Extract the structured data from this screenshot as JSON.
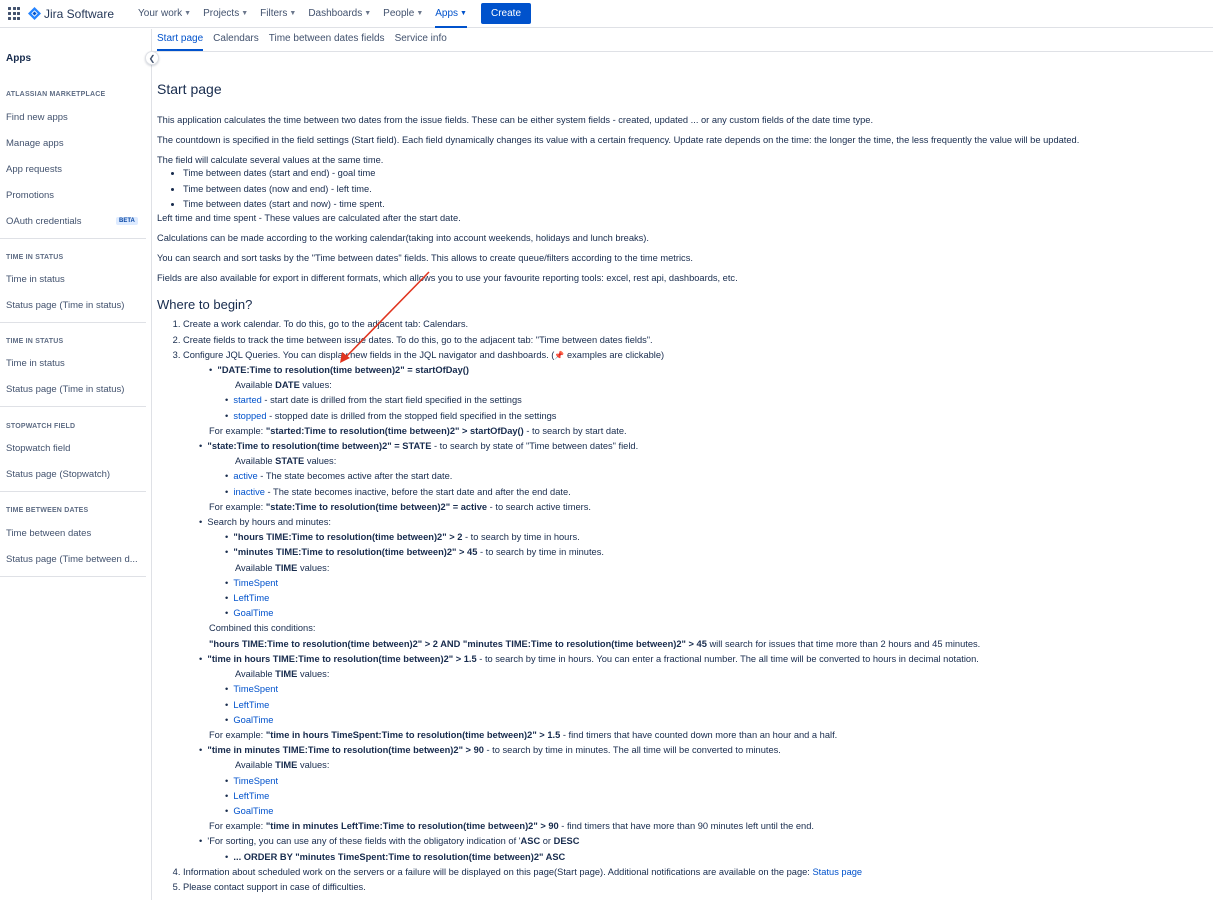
{
  "topbar": {
    "product": "Jira Software",
    "nav": [
      {
        "label": "Your work"
      },
      {
        "label": "Projects"
      },
      {
        "label": "Filters"
      },
      {
        "label": "Dashboards"
      },
      {
        "label": "People"
      },
      {
        "label": "Apps"
      }
    ],
    "create_label": "Create",
    "accent": "#0052cc"
  },
  "sidebar": {
    "title": "Apps",
    "sections": [
      {
        "heading": "ATLASSIAN MARKETPLACE",
        "items": [
          "Find new apps",
          "Manage apps",
          "App requests",
          "Promotions",
          "OAuth credentials"
        ],
        "badge": "BETA"
      },
      {
        "heading": "TIME IN STATUS",
        "items": [
          "Time in status",
          "Status page (Time in status)"
        ]
      },
      {
        "heading": "TIME IN STATUS",
        "items": [
          "Time in status",
          "Status page (Time in status)"
        ]
      },
      {
        "heading": "STOPWATCH FIELD",
        "items": [
          "Stopwatch field",
          "Status page (Stopwatch)"
        ]
      },
      {
        "heading": "TIME BETWEEN DATES",
        "items": [
          "Time between dates",
          "Status page (Time between d..."
        ]
      }
    ]
  },
  "tabs": [
    "Start page",
    "Calendars",
    "Time between dates fields",
    "Service info"
  ],
  "content": {
    "title": "Start page",
    "p1": "This application calculates the time between two dates from the issue fields. These can be either system fields - created, updated ... or any custom fields of the date time type.",
    "p2": "The countdown is specified in the field settings (Start field). Each field dynamically changes its value with a certain frequency. Update rate depends on the time: the longer the time, the less frequently the value will be updated.",
    "p3": "The field will calculate several values at the same time.",
    "values_list": [
      "Time between dates (start and end) - goal time",
      "Time between dates (now and end) - left time.",
      "Time between dates (start and now) - time spent."
    ],
    "p4": "Left time and time spent - These values are calculated after the start date.",
    "p5": "Calculations can be made according to the working calendar(taking into account weekends, holidays and lunch breaks).",
    "p6": "You can search and sort tasks by the \"Time between dates\" fields. This allows to create queue/filters according to the time metrics.",
    "p7": "Fields are also available for export in different formats, which allows you to use your favourite reporting tools: excel, rest api, dashboards, etc.",
    "where_title": "Where to begin?",
    "step1": "Create a work calendar. To do this, go to the adjacent tab: Calendars.",
    "step2": "Create fields to track the time between issue dates. To do this, go to the adjacent tab: \"Time between dates fields\".",
    "step3a": "Configure JQL Queries. You can display new fields in the JQL navigator and dashboards. (",
    "step3b": " examples are clickable)",
    "q1": "\"DATE:Time to resolution(time between)2\" = startOfDay()",
    "avail": "Available ",
    "date_word": "DATE",
    "state_word": "STATE",
    "time_word": "TIME",
    "values_word": " values:",
    "started": "started",
    "started_desc": " - start date is drilled from the start field specified in the settings",
    "stopped": "stopped",
    "stopped_desc": " - stopped date is drilled from the stopped field specified in the settings",
    "for_example": "For example: ",
    "ex1": "\"started:Time to resolution(time between)2\" > startOfDay()",
    "ex1_desc": " - to search by start date.",
    "q2": "\"state:Time to resolution(time between)2\" = STATE",
    "q2_desc": " - to search by state of \"Time between dates\" field.",
    "active": "active",
    "active_desc": " - The state becomes active after the start date.",
    "inactive": "inactive",
    "inactive_desc": " - The state becomes inactive, before the start date and after the end date.",
    "ex2": "\"state:Time to resolution(time between)2\" = active",
    "ex2_desc": " - to search active timers.",
    "search_hm": "Search by hours and minutes:",
    "hm1": "\"hours TIME:Time to resolution(time between)2\" > 2",
    "hm1_desc": " - to search by time in hours.",
    "hm2": "\"minutes TIME:Time to resolution(time between)2\" > 45",
    "hm2_desc": " - to search by time in minutes.",
    "t_spent": "TimeSpent",
    "t_left": "LeftTime",
    "t_goal": "GoalTime",
    "combined": "Combined this conditions:",
    "combined_q": "\"hours TIME:Time to resolution(time between)2\" > 2 AND \"minutes TIME:Time to resolution(time between)2\" > 45",
    "combined_desc": " will search for issues that time more than 2 hours and 45 minutes.",
    "q3": "\"time in hours TIME:Time to resolution(time between)2\" > 1.5",
    "q3_desc": " - to search by time in hours. You can enter a fractional number. The all time will be converted to hours in decimal notation.",
    "ex3": "\"time in hours TimeSpent:Time to resolution(time between)2\" > 1.5",
    "ex3_desc": " - find timers that have counted down more than an hour and a half.",
    "q4": "\"time in minutes TIME:Time to resolution(time between)2\" > 90",
    "q4_desc": " - to search by time in minutes. The all time will be converted to minutes.",
    "ex4": "\"time in minutes LeftTime:Time to resolution(time between)2\" > 90",
    "ex4_desc": " - find timers that have more than 90 minutes left until the end.",
    "sort_a": "'For sorting, you can use any of these fields with the obligatory indication of '",
    "asc": "ASC",
    "sort_or": " or ",
    "desc": "DESC",
    "order_by": "... ORDER BY \"minutes TimeSpent:Time to resolution(time between)2\" ASC",
    "step4": "Information about scheduled work on the servers or a failure will be displayed on this page(Start page). Additional notifications are available on the page: ",
    "status_page_link": "Status page",
    "step5": "Please contact support in case of difficulties."
  }
}
